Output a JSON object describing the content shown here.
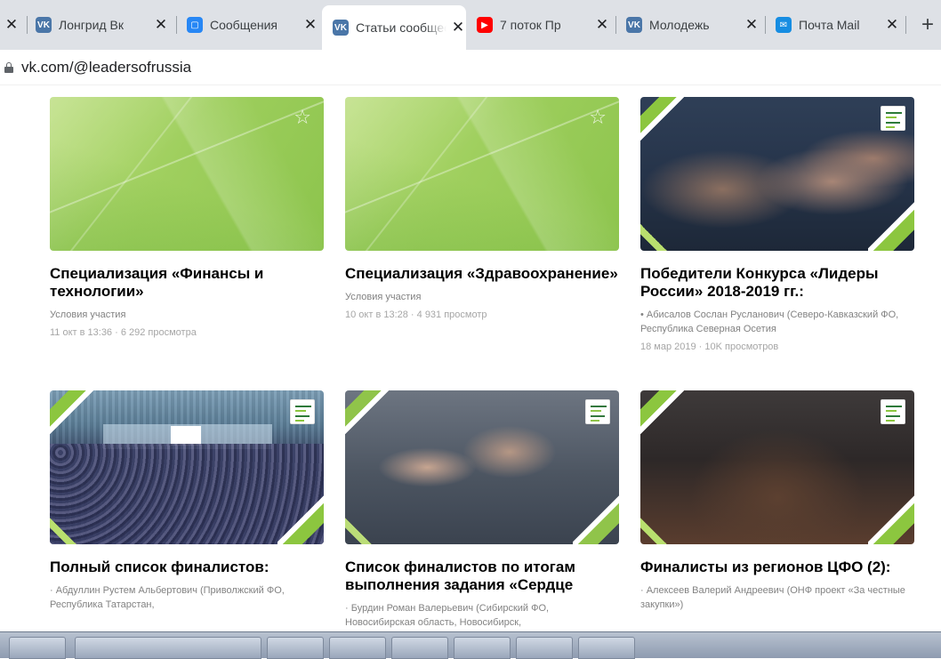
{
  "browser": {
    "tabs": [
      {
        "title": "Лонгрид Вк",
        "icon": "vk-icon",
        "color": "#4a76a8",
        "active": false
      },
      {
        "title": "Сообщения",
        "icon": "message-icon",
        "color": "#2787f5",
        "active": false
      },
      {
        "title": "Статьи сообщества",
        "icon": "vk-icon",
        "color": "#4a76a8",
        "active": true
      },
      {
        "title": "7 поток Пр",
        "icon": "youtube-icon",
        "color": "#ff0000",
        "active": false
      },
      {
        "title": "Молодежь",
        "icon": "vk-icon",
        "color": "#4a76a8",
        "active": false
      },
      {
        "title": "Почта Mail",
        "icon": "mail-icon",
        "color": "#168de2",
        "active": false
      }
    ],
    "close_glyph": "✕",
    "new_tab_glyph": "+",
    "partial_tab_close": "✕",
    "url": "vk.com/@leadersofrussia"
  },
  "articles": [
    {
      "title": "Специализация «Финансы и технологии»",
      "subtitle": "Условия участия",
      "meta": "11 окт в 13:36 · 6 292 просмотра",
      "thumb": "green",
      "starred": true
    },
    {
      "title": "Специализация «Здравоохранение»",
      "subtitle": "Условия участия",
      "meta": "10 окт в 13:28 · 4 931 просмотр",
      "thumb": "green",
      "starred": true
    },
    {
      "title": "Победители Конкурса «Лидеры России» 2018-2019 гг.:",
      "subtitle": "• Абисалов Сослан Русланович (Северо-Кавказский ФО, Республика Северная Осетия",
      "meta": "18 мар 2019 · 10K просмотров",
      "thumb": "photo-a",
      "starred": false
    },
    {
      "title": "Полный список финалистов:",
      "subtitle": "· Абдуллин Рустем Альбертович (Приволжский ФО, Республика Татарстан,",
      "meta": "",
      "thumb": "photo-b",
      "starred": false
    },
    {
      "title": "Список финалистов по итогам выполнения задания «Сердце",
      "subtitle": "· Бурдин Роман Валерьевич (Сибирский ФО, Новосибирская область, Новосибирск,",
      "meta": "",
      "thumb": "photo-c",
      "starred": false
    },
    {
      "title": "Финалисты из регионов ЦФО (2):",
      "subtitle": "· Алексеев Валерий Андреевич (ОНФ проект «За честные закупки»)",
      "meta": "",
      "thumb": "photo-d",
      "starred": false
    }
  ],
  "star_glyph": "☆",
  "favicon_glyphs": {
    "vk-icon": "VK",
    "message-icon": "▢",
    "youtube-icon": "▶",
    "mail-icon": "✉"
  }
}
